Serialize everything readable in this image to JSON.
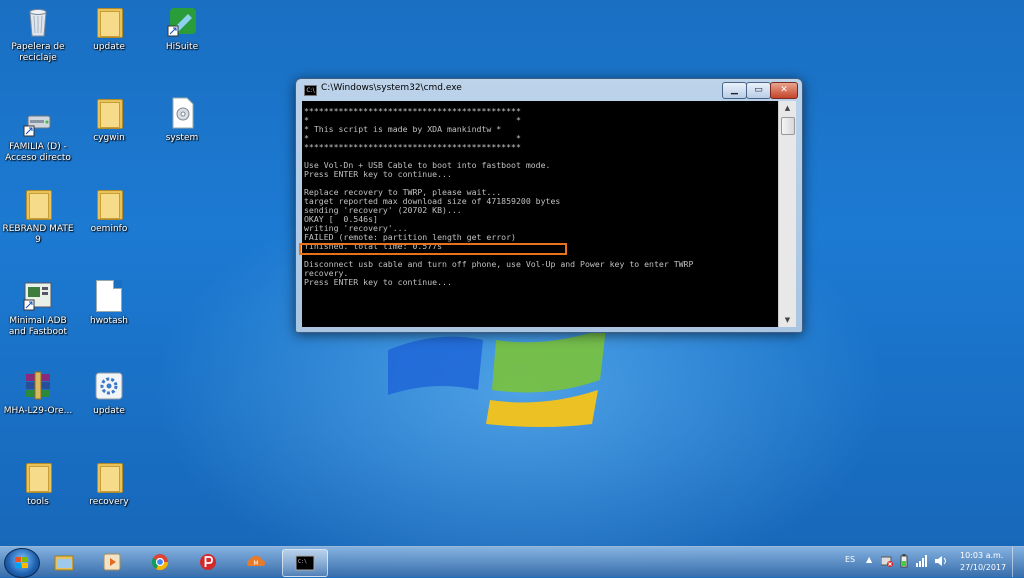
{
  "desktop": {
    "icons": [
      {
        "label": "Papelera de reciclaje"
      },
      {
        "label": "update"
      },
      {
        "label": "HiSuite"
      },
      {
        "label": "FAMILIA (D) - Acceso directo"
      },
      {
        "label": "cygwin"
      },
      {
        "label": "system"
      },
      {
        "label": "REBRAND MATE 9"
      },
      {
        "label": "oeminfo"
      },
      {
        "label": "Minimal ADB and Fastboot"
      },
      {
        "label": "hwotash"
      },
      {
        "label": "MHA-L29-Ore..."
      },
      {
        "label": "update"
      },
      {
        "label": "tools"
      },
      {
        "label": "recovery"
      }
    ]
  },
  "window": {
    "title": "C:\\Windows\\system32\\cmd.exe",
    "icon": "cmd-icon",
    "minimize_label": "▁",
    "maximize_label": "▭",
    "close_label": "✕",
    "console_text": "********************************************\n*                                          *\n* This script is made by XDA mankindtw *\n*                                          *\n********************************************\n\nUse Vol-Dn + USB Cable to boot into fastboot mode.\nPress ENTER key to continue...\n\nReplace recovery to TWRP, please wait...\ntarget reported max download size of 471859200 bytes\nsending 'recovery' (20702 KB)...\nOKAY [  0.546s]\nwriting 'recovery'...\nFAILED (remote: partition length get error)\nfinished. total time: 0.577s\n\nDisconnect usb cable and turn off phone, use Vol-Up and Power key to enter TWRP\nrecovery.\nPress ENTER key to continue..."
  },
  "taskbar": {
    "items": [
      "windows-explorer-icon",
      "media-player-icon",
      "chrome-icon",
      "psiphon-icon",
      "mega-icon",
      "cmd-icon"
    ],
    "tray": {
      "language": "ES",
      "time": "10:03 a.m.",
      "date": "27/10/2017"
    }
  },
  "colors": {
    "highlight": "#e8721c",
    "console_bg": "#000000",
    "console_fg": "#c0c0c0"
  }
}
